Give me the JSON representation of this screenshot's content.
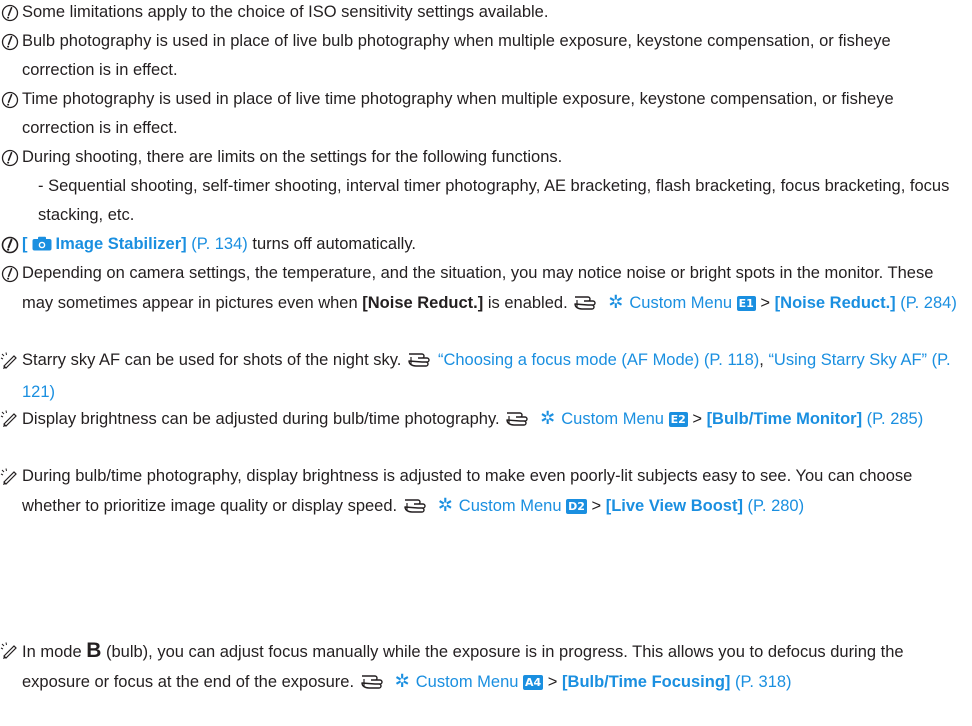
{
  "notes": [
    {
      "text": "Some limitations apply to the choice of ISO sensitivity settings available."
    },
    {
      "text": "Bulb photography is used in place of live bulb photography when multiple exposure, keystone compensation, or fisheye correction is in effect."
    },
    {
      "text": "Time photography is used in place of live time photography when multiple exposure, keystone compensation, or fisheye correction is in effect."
    },
    {
      "text": "During shooting, there are limits on the settings for the following functions.",
      "sub": "- Sequential shooting, self-timer shooting, interval timer photography, AE bracketing, flash bracketing, focus bracketing, focus stacking, etc."
    },
    {
      "bracket_open": "[",
      "label": "Image Stabilizer]",
      "page": "(P. 134)",
      "rest": " turns off automatically."
    },
    {
      "text": "Depending on camera settings, the temperature, and the situation, you may notice noise or bright spots in the monitor. These may sometimes appear in pictures even when ",
      "bold": "[Noise Reduct.]",
      "after": " is enabled.",
      "ref": {
        "menu": "Custom Menu",
        "tab": "E1",
        "sep": " > ",
        "item": "[Noise Reduct.]",
        "page": " (P. 284)"
      }
    }
  ],
  "tips": [
    {
      "text": "Starry sky AF can be used for shots of the night sky.",
      "link1": "“Choosing a focus mode (AF Mode) (P. 118)",
      "comma": ", ",
      "link2": "“Using Starry Sky AF” (P. 121)"
    },
    {
      "text": "Display brightness can be adjusted during bulb/time photography.",
      "ref": {
        "menu": "Custom Menu",
        "tab": "E2",
        "sep": " > ",
        "item": "[Bulb/Time Monitor]",
        "page": " (P. 285)"
      }
    },
    {
      "text": "During bulb/time photography, display brightness is adjusted to make even poorly-lit subjects easy to see. You can choose whether to prioritize image quality or display speed.",
      "ref": {
        "menu": "Custom Menu",
        "tab": "D2",
        "sep": " > ",
        "item": "[Live View Boost]",
        "page": " (P. 280)"
      }
    },
    {
      "pre": "In mode ",
      "mode": "B",
      "text": " (bulb), you can adjust focus manually while the exposure is in progress. This allows you to defocus during the exposure or focus at the end of the exposure.",
      "ref": {
        "menu": "Custom Menu",
        "tab": "A4",
        "sep": " > ",
        "item": "[Bulb/Time Focusing]",
        "page": " (P. 318)"
      }
    }
  ],
  "icons": {
    "caution": "caution-icon",
    "tip": "pencil-tip-icon",
    "ref": "pointing-hand-icon",
    "gear": "custom-menu-gear-icon",
    "camera": "camera-icon"
  },
  "colors": {
    "link": "#1a8fe0",
    "text": "#231f20"
  }
}
